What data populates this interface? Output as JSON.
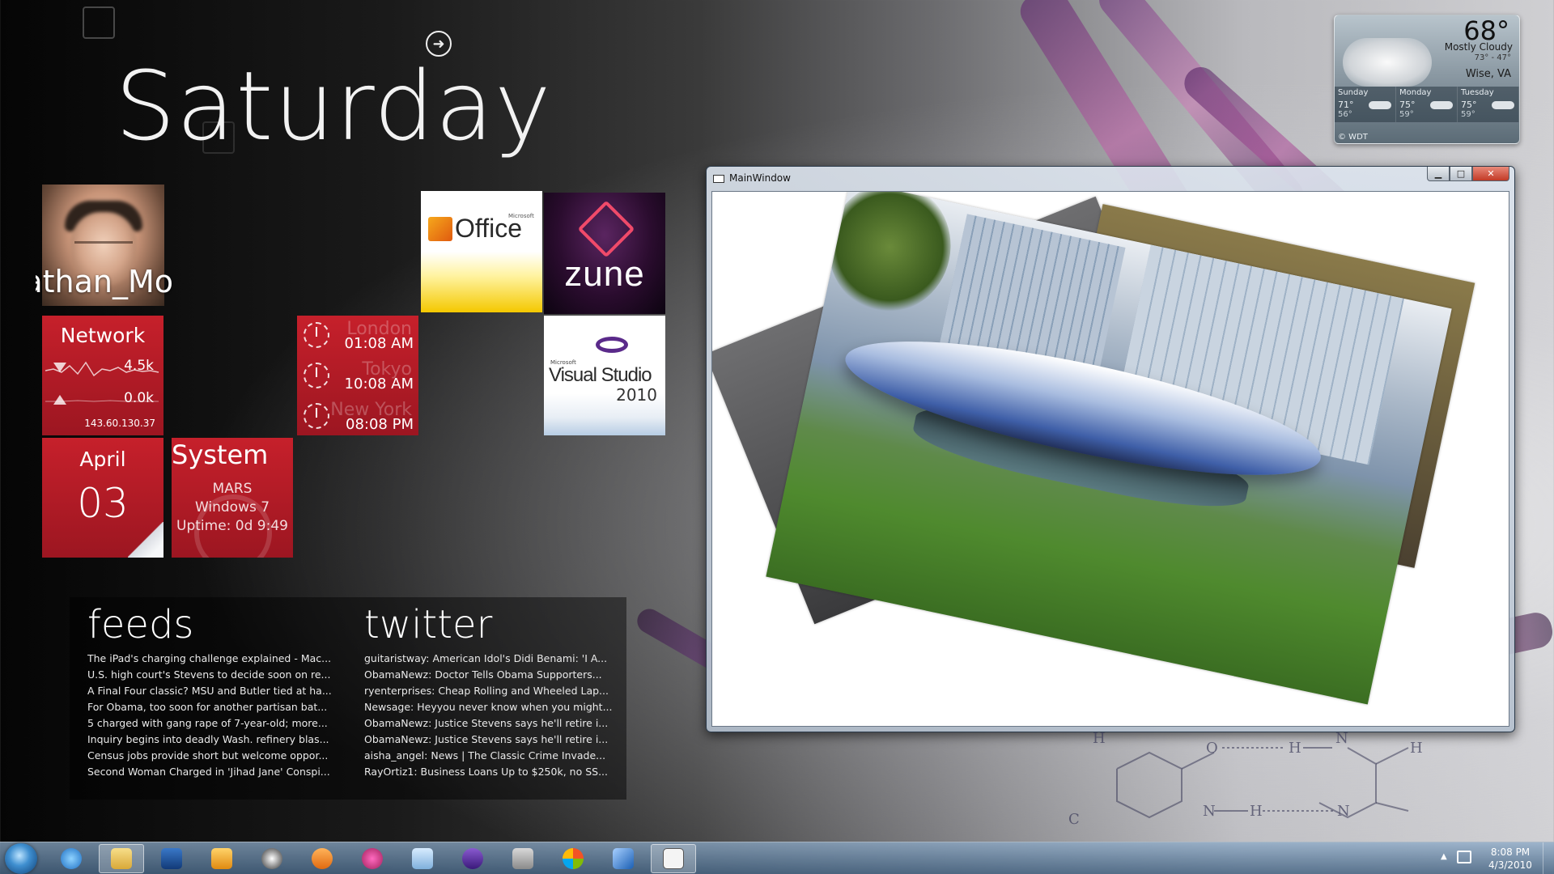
{
  "dashboard": {
    "day": "Saturday",
    "profile_name": "Jonathan_Mo",
    "network": {
      "title": "Network",
      "down": "4.5k",
      "up": "0.0k",
      "ip": "143.60.130.37"
    },
    "calendar": {
      "month": "April",
      "date": "03"
    },
    "system": {
      "title": "System",
      "machine": "MARS",
      "os": "Windows 7",
      "uptime": "Uptime: 0d 9:49"
    },
    "clocks": [
      {
        "city": "London",
        "time": "01:08 AM"
      },
      {
        "city": "Tokyo",
        "time": "10:08 AM"
      },
      {
        "city": "New York",
        "time": "08:08 PM"
      }
    ],
    "apps": {
      "office": {
        "name": "Office",
        "vendor": "Microsoft"
      },
      "zune": {
        "name": "zune"
      },
      "visual_studio": {
        "vendor": "Microsoft",
        "name": "Visual Studio",
        "year": "2010"
      }
    }
  },
  "feeds": {
    "title": "feeds",
    "items": [
      "The iPad's charging challenge explained - Mac...",
      "U.S. high court's Stevens to decide soon on re...",
      "A Final Four classic? MSU and Butler tied at ha...",
      "For Obama, too soon for another partisan bat...",
      "5 charged with gang rape of 7-year-old; more...",
      "Inquiry begins into deadly Wash. refinery blas...",
      "Census jobs provide short but welcome oppor...",
      "Second Woman Charged in 'Jihad Jane' Conspi..."
    ]
  },
  "twitter": {
    "title": "twitter",
    "items": [
      "guitaristway: American Idol's Didi Benami: 'I A...",
      "ObamaNewz: Doctor Tells Obama Supporters...",
      "ryenterprises: Cheap Rolling and Wheeled Lap...",
      "Newsage: Heyyou never know when you might...",
      "ObamaNewz: Justice Stevens says he'll retire i...",
      "ObamaNewz: Justice Stevens says he'll retire i...",
      "aisha_angel: News | The Classic Crime Invade...",
      "RayOrtiz1: Business Loans Up to $250k, no SS..."
    ]
  },
  "weather": {
    "temp": "68°",
    "condition": "Mostly Cloudy",
    "range": "73° - 47°",
    "location": "Wise, VA",
    "forecast": [
      {
        "day": "Sunday",
        "hi": "71°",
        "lo": "56°"
      },
      {
        "day": "Monday",
        "hi": "75°",
        "lo": "59°"
      },
      {
        "day": "Tuesday",
        "hi": "75°",
        "lo": "59°"
      }
    ],
    "credit": "© WDT"
  },
  "window": {
    "title": "MainWindow",
    "minimize": "▁",
    "maximize": "□",
    "close": "✕"
  },
  "dna_labels": {
    "o": "O",
    "h1": "H",
    "n1": "N",
    "h2": "H",
    "n2": "N",
    "h3": "H",
    "c": "C",
    "h4": "H",
    "n3": "N"
  },
  "taskbar": {
    "time": "8:08 PM",
    "date": "4/3/2010",
    "apps": [
      "internet-explorer",
      "windows-explorer",
      "powershell",
      "outlook",
      "messenger",
      "media-player",
      "paint-app",
      "photo-viewer",
      "visual-studio",
      "task-manager",
      "windows-logo",
      "remote-desktop",
      "mainwindow-app"
    ]
  },
  "colors": {
    "tile_red": "#b51c27",
    "accent_blue": "#3f8fd0"
  }
}
